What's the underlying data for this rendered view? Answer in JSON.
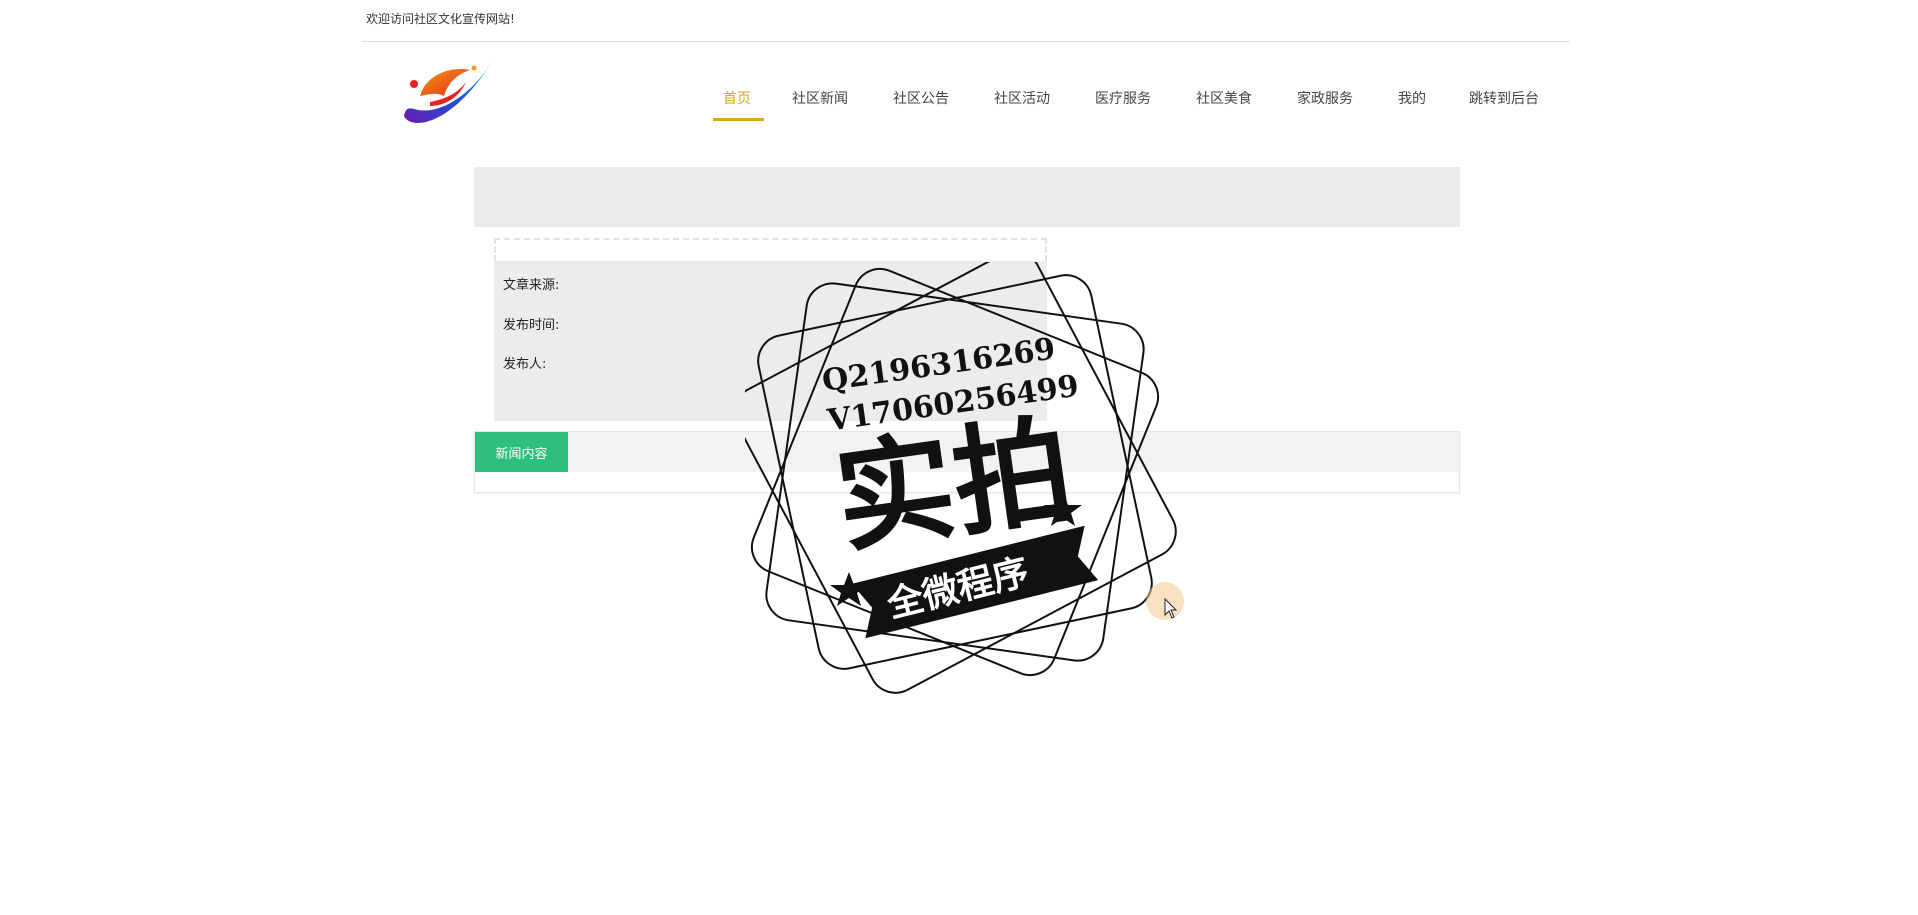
{
  "header": {
    "welcome_text": "欢迎访问社区文化宣传网站!"
  },
  "logo": {
    "icon": "site-logo-swirl",
    "colors": [
      "#e8231c",
      "#f39c12",
      "#1d4fd8",
      "#6a1bb0"
    ]
  },
  "nav": {
    "items": [
      {
        "label": "首页",
        "active": true
      },
      {
        "label": "社区新闻",
        "active": false
      },
      {
        "label": "社区公告",
        "active": false
      },
      {
        "label": "社区活动",
        "active": false
      },
      {
        "label": "医疗服务",
        "active": false
      },
      {
        "label": "社区美食",
        "active": false
      },
      {
        "label": "家政服务",
        "active": false
      },
      {
        "label": "我的",
        "active": false
      },
      {
        "label": "跳转到后台",
        "active": false
      }
    ],
    "active_color": "#d9a61a"
  },
  "article_info": {
    "source_label": "文章来源:",
    "time_label": "发布时间:",
    "publisher_label": "发布人:"
  },
  "news_panel": {
    "tab_label": "新闻内容",
    "tab_color": "#2fbf7d"
  },
  "watermark": {
    "line1": "Q2196316269",
    "line2": "V17060256499",
    "big_text": "实拍",
    "ribbon_text": "全微程序",
    "icon": "stamp-seal"
  },
  "cursor": {
    "icon": "mouse-pointer-icon"
  }
}
